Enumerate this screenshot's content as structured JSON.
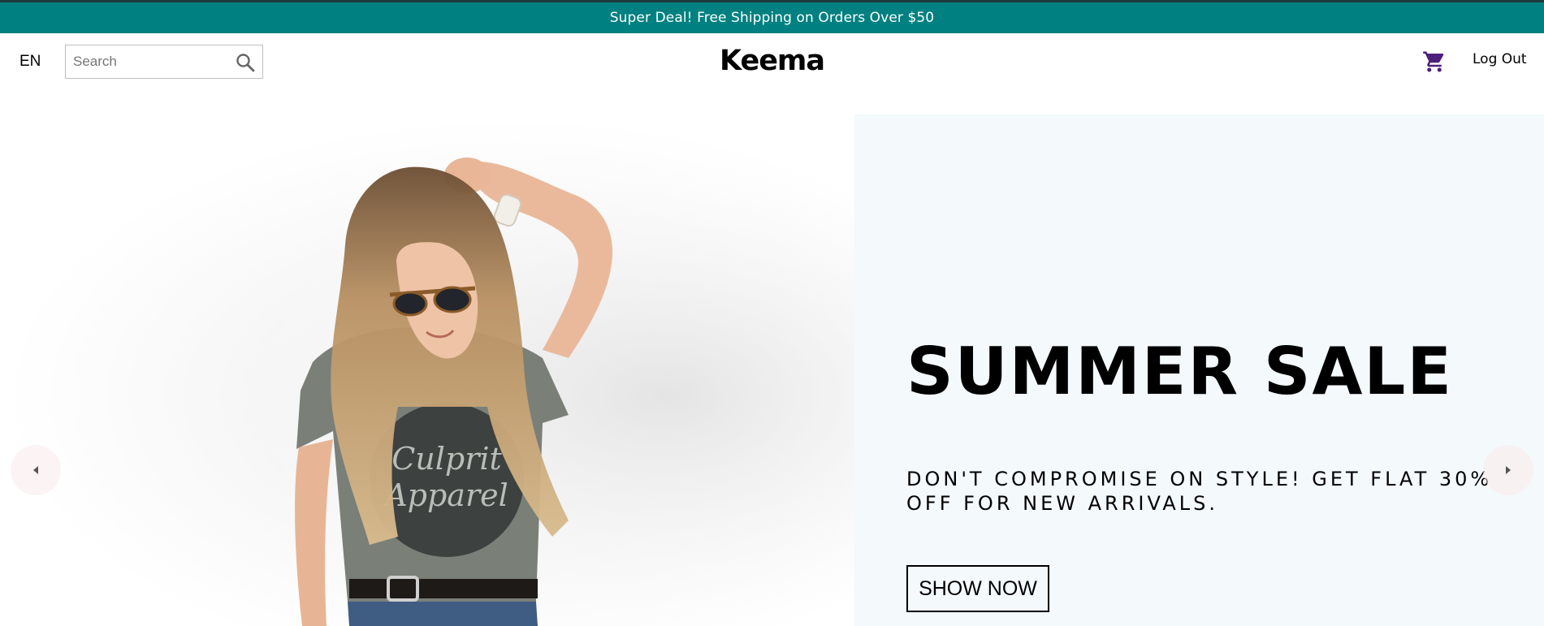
{
  "announcement": {
    "text": "Super Deal! Free Shipping on Orders Over $50",
    "background": "#008080"
  },
  "header": {
    "language": "EN",
    "search": {
      "placeholder": "Search",
      "value": "",
      "icon": "search-icon"
    },
    "logo": "Keema",
    "cart_icon": "cart-icon",
    "cart_color": "#4b1f7a",
    "logout_label": "Log Out"
  },
  "hero": {
    "image": {
      "description_icon": "model-photo",
      "shirt_text": "Culprit Apparel"
    },
    "title": "SUMMER SALE",
    "subtitle": "DON'T COMPROMISE ON STYLE! GET FLAT 30% OFF FOR NEW ARRIVALS.",
    "cta_label": "SHOW NOW",
    "panel_background": "#f4f9fb",
    "prev_icon": "caret-left-icon",
    "next_icon": "caret-right-icon"
  }
}
